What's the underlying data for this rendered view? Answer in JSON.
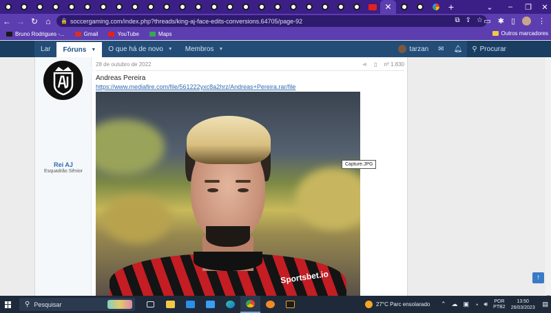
{
  "browser": {
    "url": "soccergaming.com/index.php?threads/king-aj-face-edits-conversions.64705/page-92",
    "active_tab_close": "✕",
    "new_tab": "+"
  },
  "bookmarks": {
    "items": [
      {
        "label": "Bruno Rodrigues -...",
        "color": "#1a1a1a"
      },
      {
        "label": "Gmail",
        "color": "#d93025"
      },
      {
        "label": "YouTube",
        "color": "#e62117"
      },
      {
        "label": "Maps",
        "color": "#34a853"
      }
    ],
    "other": "Outros marcadores"
  },
  "forum_nav": {
    "home": "Lar",
    "forums": "Fóruns",
    "whats_new": "O que há de novo",
    "members": "Membros",
    "user": "tarzan",
    "search": "Procurar"
  },
  "post": {
    "author": "Rei AJ",
    "author_title": "Esquadrão Sênior",
    "date": "28 de outubro de 2022",
    "post_number": "nº 1.830",
    "title": "Andreas Pereira",
    "link": "https://www.mediafire.com/file/561222yxc8a2hrz/Andreas+Pereira.rar/file",
    "image_tooltip": "Capture.JPG",
    "jersey_text": "Sportsbet.io"
  },
  "taskbar": {
    "search_placeholder": "Pesquisar",
    "weather": "27°C  Parc ensolarado",
    "lang_top": "POR",
    "lang_bottom": "PTB2",
    "time": "13:50",
    "date": "26/03/2023"
  }
}
